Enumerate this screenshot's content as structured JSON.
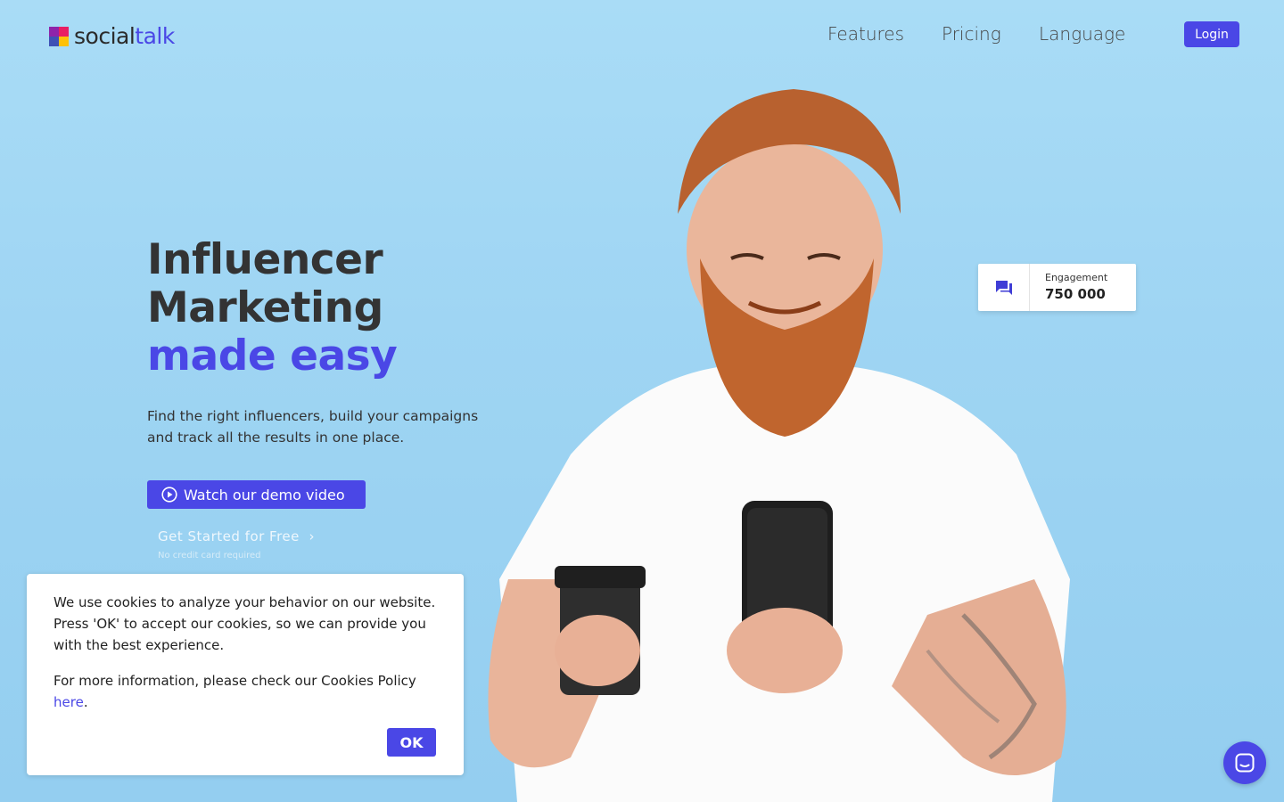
{
  "brand": {
    "part1": "social",
    "part2": "talk"
  },
  "nav": {
    "features": "Features",
    "pricing": "Pricing",
    "language": "Language",
    "login": "Login"
  },
  "hero": {
    "line1": "Influencer",
    "line2": "Marketing",
    "line3": "made easy",
    "subtitle": "Find the right influencers, build your campaigns and track all the results in one place.",
    "demo_button": "Watch our demo video",
    "get_started": "Get Started for Free",
    "no_credit": "No credit card required"
  },
  "engagement": {
    "label": "Engagement",
    "value": "750 000"
  },
  "cookie": {
    "text1": "We use cookies to analyze your behavior on our website. Press 'OK' to accept our cookies, so we can provide you with the best experience.",
    "text2_prefix": "For more information, please check our Cookies Policy ",
    "link": "here",
    "text2_suffix": ".",
    "ok": "OK"
  },
  "colors": {
    "accent": "#4a47e6",
    "background": "#a9dcf6"
  },
  "icons": {
    "engagement": "chat-bubbles-icon",
    "demo": "play-circle-icon",
    "chat": "chat-icon",
    "started": "chevron-right-icon"
  }
}
